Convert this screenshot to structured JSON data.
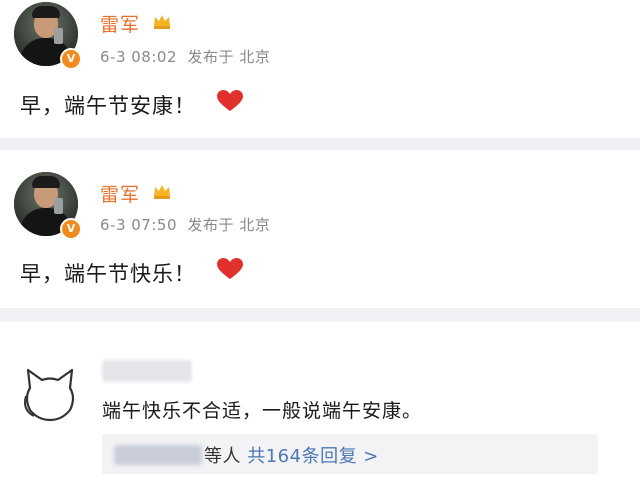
{
  "posts": [
    {
      "username": "雷军",
      "verified_badge": "V",
      "timestamp": "6-3 08:02",
      "location": "发布于 北京",
      "content": "早，端午节安康！",
      "icons": [
        "avatar",
        "crown-icon",
        "verified-badge-icon",
        "heart-icon"
      ]
    },
    {
      "username": "雷军",
      "verified_badge": "V",
      "timestamp": "6-3 07:50",
      "location": "发布于 北京",
      "content": "早，端午节快乐！",
      "icons": [
        "avatar",
        "crown-icon",
        "verified-badge-icon",
        "heart-icon"
      ]
    }
  ],
  "comment": {
    "avatar_icon": "cat-outline-icon",
    "text": "端午快乐不合适，一般说端午安康。",
    "reply_summary": {
      "others": "等人",
      "count_text": "共164条回复 >"
    }
  },
  "colors": {
    "username": "#e8712a",
    "meta": "#8a8a8a",
    "heart": "#e0322a",
    "badge": "#f28a1c",
    "link": "#4a78b3",
    "separator": "#f0f1f4"
  }
}
